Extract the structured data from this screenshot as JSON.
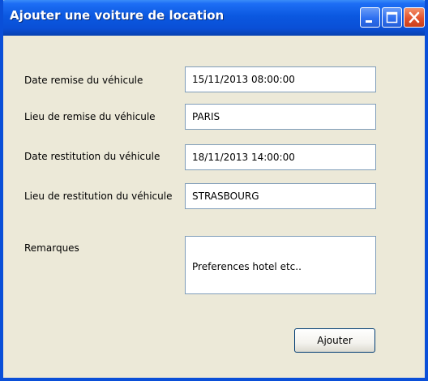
{
  "window": {
    "title": "Ajouter une voiture de location"
  },
  "form": {
    "fields": [
      {
        "label": "Date remise du véhicule",
        "value": "15/11/2013 08:00:00"
      },
      {
        "label": "Lieu de remise du véhicule",
        "value": "PARIS"
      },
      {
        "label": "Date restitution du véhicule",
        "value": "18/11/2013 14:00:00"
      },
      {
        "label": "Lieu de restitution du véhicule",
        "value": "STRASBOURG"
      }
    ],
    "remarks_label": "Remarques",
    "remarks_value": "Preferences hotel etc..",
    "submit_label": "Ajouter"
  },
  "colors": {
    "titlebar": "#0a4fd6",
    "window_bg": "#ece9d8",
    "close_button": "#e2522d",
    "input_border": "#7f9db9"
  },
  "icons": {
    "minimize": "minimize-icon",
    "maximize": "maximize-icon",
    "close": "close-icon"
  }
}
